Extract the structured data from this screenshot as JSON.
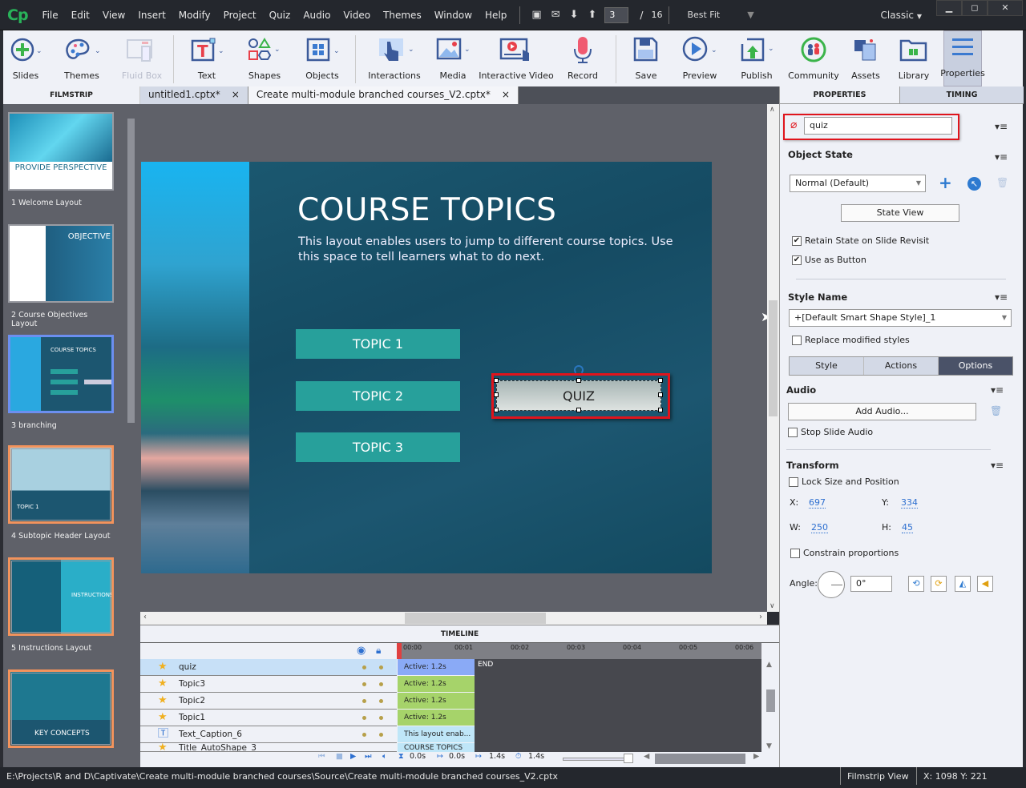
{
  "app": {
    "logo": "Cp",
    "mode": "Classic"
  },
  "menu": [
    "File",
    "Edit",
    "View",
    "Insert",
    "Modify",
    "Project",
    "Quiz",
    "Audio",
    "Video",
    "Themes",
    "Window",
    "Help"
  ],
  "nav": {
    "current_slide": "3",
    "separator": "/",
    "total_slides": "16",
    "zoom": "Best Fit"
  },
  "toolbar": [
    {
      "label": "Slides",
      "icon": "add-slide-icon"
    },
    {
      "label": "Themes",
      "icon": "palette-icon"
    },
    {
      "label": "Fluid Box",
      "icon": "fluid-box-icon",
      "disabled": true
    },
    {
      "label": "Text",
      "icon": "text-icon"
    },
    {
      "label": "Shapes",
      "icon": "shapes-icon"
    },
    {
      "label": "Objects",
      "icon": "objects-icon"
    },
    {
      "label": "Interactions",
      "icon": "hand-pointer-icon"
    },
    {
      "label": "Media",
      "icon": "image-icon"
    },
    {
      "label": "Interactive Video",
      "icon": "interactive-video-icon"
    },
    {
      "label": "Record",
      "icon": "microphone-icon"
    },
    {
      "label": "Save",
      "icon": "save-icon"
    },
    {
      "label": "Preview",
      "icon": "play-icon"
    },
    {
      "label": "Publish",
      "icon": "publish-icon"
    },
    {
      "label": "Community",
      "icon": "community-icon"
    },
    {
      "label": "Assets",
      "icon": "assets-icon"
    },
    {
      "label": "Library",
      "icon": "library-icon"
    },
    {
      "label": "Properties",
      "icon": "properties-icon"
    }
  ],
  "filmstrip": {
    "title": "FILMSTRIP",
    "slides": [
      {
        "label": "1 Welcome Layout",
        "thumb_text": "PROVIDE PERSPECTIVE"
      },
      {
        "label": "2 Course Objectives Layout",
        "thumb_text": "OBJECTIVE"
      },
      {
        "label": "3 branching",
        "thumb_text": "COURSE TOPICS"
      },
      {
        "label": "4 Subtopic Header Layout",
        "thumb_text": "TOPIC 1"
      },
      {
        "label": "5 Instructions Layout",
        "thumb_text": "INSTRUCTIONS"
      },
      {
        "label": "",
        "thumb_text": "KEY CONCEPTS"
      }
    ]
  },
  "doc_tabs": [
    {
      "label": "untitled1.cptx*",
      "close": "×"
    },
    {
      "label": "Create multi-module branched courses_V2.cptx*",
      "close": "×"
    }
  ],
  "slide": {
    "title": "COURSE TOPICS",
    "body": "This layout enables users to jump to different course topics. Use this space to tell learners what to do next.",
    "buttons": [
      "TOPIC 1",
      "TOPIC 2",
      "TOPIC 3"
    ],
    "quiz_button": "QUIZ"
  },
  "timeline": {
    "title": "TIMELINE",
    "ruler": [
      "00:00",
      "00:01",
      "00:02",
      "00:03",
      "00:04",
      "00:05",
      "00:06"
    ],
    "end_label": "END",
    "rows": [
      {
        "name": "quiz",
        "bar": "Active: 1.2s",
        "icon": "star-icon",
        "selected": true
      },
      {
        "name": "Topic3",
        "bar": "Active: 1.2s",
        "icon": "star-icon"
      },
      {
        "name": "Topic2",
        "bar": "Active: 1.2s",
        "icon": "star-icon"
      },
      {
        "name": "Topic1",
        "bar": "Active: 1.2s",
        "icon": "star-icon"
      },
      {
        "name": "Text_Caption_6",
        "bar": "This layout enab...",
        "icon": "text-caption-icon"
      },
      {
        "name": "Title_AutoShape_3",
        "bar": "COURSE TOPICS",
        "icon": "star-icon"
      }
    ],
    "footer": {
      "start": "0.0s",
      "lead": "0.0s",
      "duration": "1.4s",
      "total": "1.4s"
    }
  },
  "properties": {
    "tabs": [
      "PROPERTIES",
      "TIMING"
    ],
    "object_name": "quiz",
    "object_state": {
      "title": "Object State",
      "value": "Normal (Default)",
      "state_view": "State View"
    },
    "retain_state": {
      "label": "Retain State on Slide Revisit",
      "checked": true
    },
    "use_as_button": {
      "label": "Use as Button",
      "checked": true
    },
    "style_name": {
      "title": "Style Name",
      "value": "+[Default Smart Shape Style]_1"
    },
    "replace_styles": {
      "label": "Replace modified styles",
      "checked": false
    },
    "subtabs": [
      "Style",
      "Actions",
      "Options"
    ],
    "active_subtab": "Options",
    "audio": {
      "title": "Audio",
      "add": "Add Audio...",
      "stop_label": "Stop Slide Audio",
      "stop_checked": false
    },
    "transform": {
      "title": "Transform",
      "lock_label": "Lock Size and Position",
      "x_label": "X:",
      "x": "697",
      "y_label": "Y:",
      "y": "334",
      "w_label": "W:",
      "w": "250",
      "h_label": "H:",
      "h": "45",
      "constrain_label": "Constrain proportions",
      "angle_label": "Angle:",
      "angle": "0°"
    }
  },
  "status": {
    "path": "E:\\Projects\\R and D\\Captivate\\Create multi-module branched courses\\Source\\Create multi-module branched courses_V2.cptx",
    "view": "Filmstrip View",
    "coords": "X: 1098 Y: 221"
  }
}
